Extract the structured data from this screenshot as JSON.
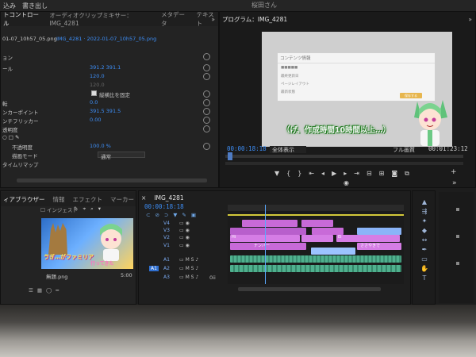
{
  "topbar": {
    "items": [
      "込み",
      "書き出し"
    ],
    "title": "桜田さん"
  },
  "effect_controls": {
    "tabs": [
      "トコントロール",
      "オーディオクリップミキサー：IMG_4281",
      "メタデータ",
      "テキスト"
    ],
    "source_clip": "01-07_10h57_05.png",
    "target_clip": "IMG_4281 · 2022-01-07_10h57_05.png",
    "rows": [
      {
        "label": "ョン",
        "value": ""
      },
      {
        "label": "ール",
        "value": "391.2   391.1"
      },
      {
        "label": "",
        "value": "120.0"
      },
      {
        "label": "",
        "value": "120.0"
      },
      {
        "label": "",
        "value": "縦横比を固定"
      },
      {
        "label": "転",
        "value": "0.0"
      },
      {
        "label": "ンカーポイント",
        "value": "391.5   391.5"
      },
      {
        "label": "ンチフリッカー",
        "value": "0.00"
      },
      {
        "label": "透明度",
        "value": ""
      },
      {
        "label": "",
        "value": ""
      },
      {
        "label": "不透明度",
        "value": "100.0 %"
      },
      {
        "label": "描画モード",
        "value": "通常"
      },
      {
        "label": "タイムリマップ",
        "value": ""
      }
    ],
    "timecode": "00:00:18:18"
  },
  "program": {
    "tab": "プログラム：IMG_4281",
    "doc_title": "コンテンツ情報",
    "doc_rows": [
      "■■■■■",
      "最終更新日",
      "ページレイアウト",
      "最新状態"
    ],
    "doc_button": "保存する",
    "caption": "（げ、作成時間10時間以上…）",
    "timecode": "00:00:18:18",
    "fit": "全体表示",
    "quality": "フル画質",
    "duration": "00:01:23:12"
  },
  "project": {
    "tabs": [
      "ィアブラウザー",
      "情報",
      "エフェクト",
      "マーカー"
    ],
    "search_label": "インジェスト",
    "thumb_text": "ゔぎ…がファミリア",
    "thumb_subtext": "行ってきた",
    "item_name": "無題.png",
    "item_duration": "5:00"
  },
  "timeline": {
    "tab": "IMG_4281",
    "timecode": "00:00:18:18",
    "tracks": [
      "V4",
      "V3",
      "V2",
      "V1",
      "A1",
      "A2",
      "A3"
    ],
    "clip_labels": [
      "Hi",
      "Ei",
      "ナンバー",
      "ささやきで"
    ],
    "audio_label": "0ii"
  },
  "colors": {
    "accent": "#3d8ef7",
    "playhead": "#5aa9ff",
    "clip_pink": "#c86ad8",
    "clip_video": "#9cc3ff",
    "clip_audio": "#4fb08e",
    "caption_outline": "#2b8a2b"
  }
}
